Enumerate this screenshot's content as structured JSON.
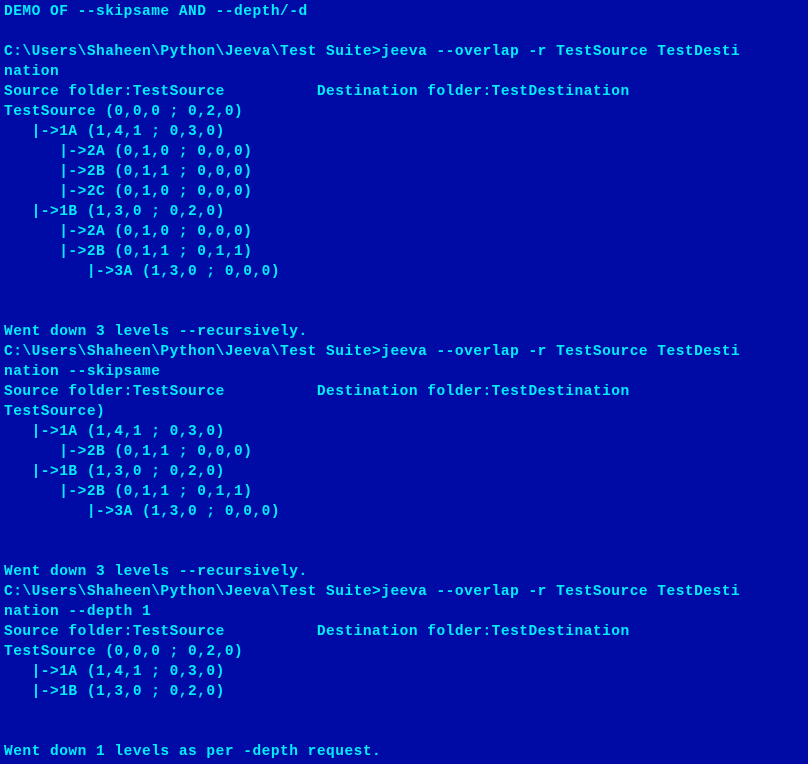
{
  "lines": [
    "DEMO OF --skipsame AND --depth/-d",
    "",
    "C:\\Users\\Shaheen\\Python\\Jeeva\\Test Suite>jeeva --overlap -r TestSource TestDesti",
    "nation",
    "Source folder:TestSource          Destination folder:TestDestination",
    "TestSource (0,0,0 ; 0,2,0)",
    "   |->1A (1,4,1 ; 0,3,0)",
    "      |->2A (0,1,0 ; 0,0,0)",
    "      |->2B (0,1,1 ; 0,0,0)",
    "      |->2C (0,1,0 ; 0,0,0)",
    "   |->1B (1,3,0 ; 0,2,0)",
    "      |->2A (0,1,0 ; 0,0,0)",
    "      |->2B (0,1,1 ; 0,1,1)",
    "         |->3A (1,3,0 ; 0,0,0)",
    "",
    "",
    "Went down 3 levels --recursively.",
    "C:\\Users\\Shaheen\\Python\\Jeeva\\Test Suite>jeeva --overlap -r TestSource TestDesti",
    "nation --skipsame",
    "Source folder:TestSource          Destination folder:TestDestination",
    "TestSource)",
    "   |->1A (1,4,1 ; 0,3,0)",
    "      |->2B (0,1,1 ; 0,0,0)",
    "   |->1B (1,3,0 ; 0,2,0)",
    "      |->2B (0,1,1 ; 0,1,1)",
    "         |->3A (1,3,0 ; 0,0,0)",
    "",
    "",
    "Went down 3 levels --recursively.",
    "C:\\Users\\Shaheen\\Python\\Jeeva\\Test Suite>jeeva --overlap -r TestSource TestDesti",
    "nation --depth 1",
    "Source folder:TestSource          Destination folder:TestDestination",
    "TestSource (0,0,0 ; 0,2,0)",
    "   |->1A (1,4,1 ; 0,3,0)",
    "   |->1B (1,3,0 ; 0,2,0)",
    "",
    "",
    "Went down 1 levels as per -depth request."
  ]
}
